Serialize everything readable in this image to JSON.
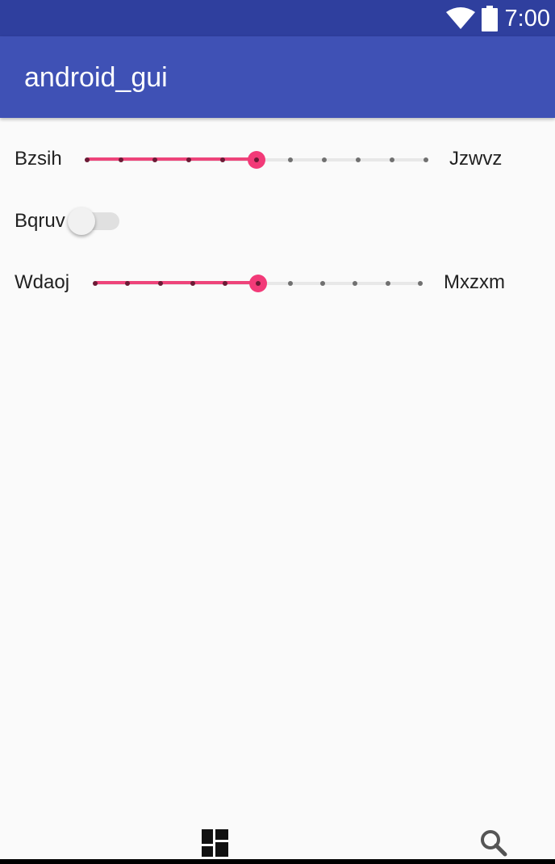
{
  "status_bar": {
    "time": "7:00",
    "wifi_icon": "wifi-icon",
    "battery_icon": "battery-icon"
  },
  "app_bar": {
    "title": "android_gui"
  },
  "controls": {
    "slider1": {
      "min_label": "Bzsih",
      "max_label": "Jzwvz",
      "steps": 10,
      "value": 5
    },
    "switch1": {
      "label": "Bqruv",
      "checked": false
    },
    "slider2": {
      "min_label": "Wdaoj",
      "max_label": "Mxzxm",
      "steps": 10,
      "value": 5
    }
  },
  "bottom_nav": {
    "items": [
      "dashboard-icon",
      "search-icon"
    ]
  },
  "colors": {
    "primary": "#3f51b5",
    "primary_dark": "#2f3f9e",
    "accent": "#f23a78",
    "background": "#fafafa"
  }
}
